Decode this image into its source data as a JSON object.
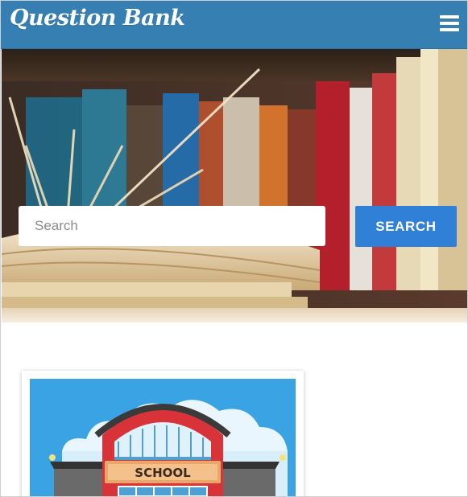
{
  "app": {
    "brand": "Question Bank"
  },
  "nav": {
    "menu_icon": "hamburger-menu-icon"
  },
  "search": {
    "placeholder": "Search",
    "value": "",
    "button_label": "SEARCH"
  },
  "card": {
    "image_sign": "SCHOOL",
    "image_subject": "school-building-illustration"
  },
  "colors": {
    "navbar": "#357fb3",
    "search_button": "#2f80d6",
    "card_sky": "#3aa3e3"
  }
}
